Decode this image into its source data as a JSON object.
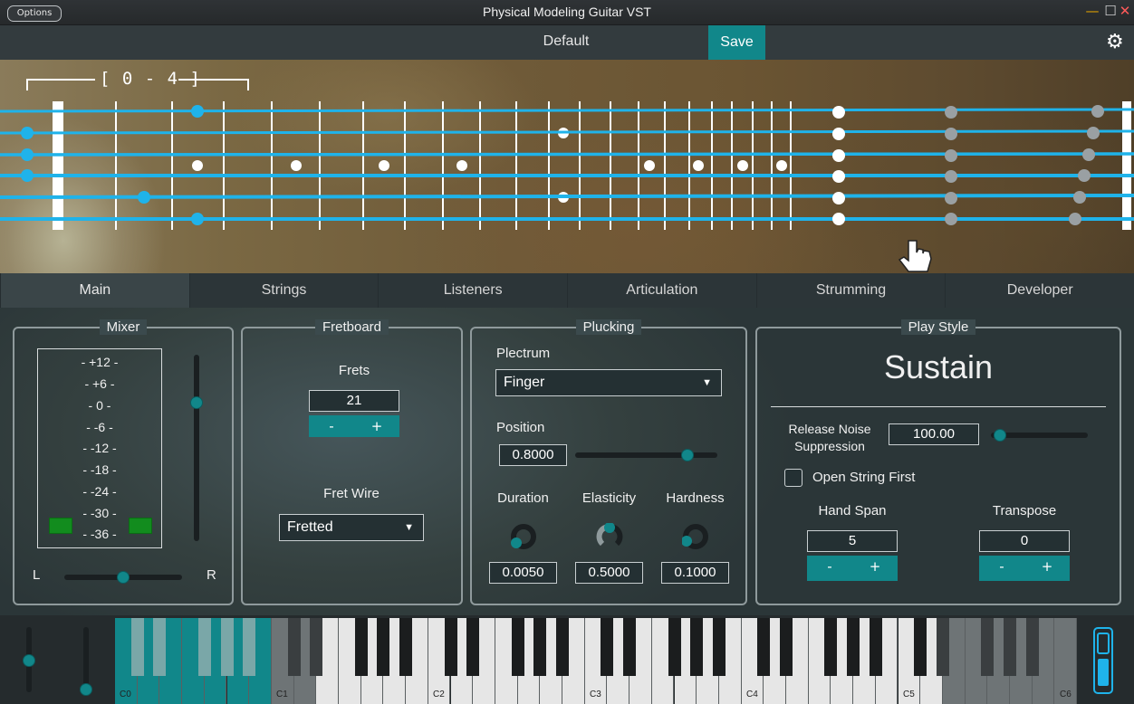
{
  "window": {
    "title": "Physical Modeling Guitar VST",
    "options_label": "Options",
    "minimize": "—",
    "maximize": "☐",
    "close": "✕"
  },
  "preset": {
    "name": "Default",
    "save_label": "Save",
    "settings_icon": "gear-icon"
  },
  "fretboard": {
    "range_label": "[ 0 - 4 ]"
  },
  "tabs": [
    {
      "label": "Main",
      "active": true
    },
    {
      "label": "Strings",
      "active": false
    },
    {
      "label": "Listeners",
      "active": false
    },
    {
      "label": "Articulation",
      "active": false
    },
    {
      "label": "Strumming",
      "active": false
    },
    {
      "label": "Developer",
      "active": false
    }
  ],
  "mixer": {
    "title": "Mixer",
    "db_scale": [
      "- +12 -",
      "- +6 -",
      "- 0 -",
      "- -6 -",
      "- -12 -",
      "- -18 -",
      "- -24 -",
      "- -30 -",
      "- -36 -"
    ],
    "left_label": "L",
    "right_label": "R",
    "volume": 0.62,
    "pan": 0.5
  },
  "fretboard_group": {
    "title": "Fretboard",
    "frets_label": "Frets",
    "frets_value": "21",
    "fret_wire_label": "Fret Wire",
    "fret_wire_value": "Fretted"
  },
  "plucking": {
    "title": "Plucking",
    "plectrum_label": "Plectrum",
    "plectrum_value": "Finger",
    "position_label": "Position",
    "position_value": "0.8000",
    "duration_label": "Duration",
    "duration_value": "0.0050",
    "elasticity_label": "Elasticity",
    "elasticity_value": "0.5000",
    "hardness_label": "Hardness",
    "hardness_value": "0.1000"
  },
  "play_style": {
    "title": "Play Style",
    "mode": "Sustain",
    "release_noise_label_1": "Release Noise",
    "release_noise_label_2": "Suppression",
    "release_noise_value": "100.00",
    "open_string_label": "Open String First",
    "hand_span_label": "Hand Span",
    "hand_span_value": "5",
    "transpose_label": "Transpose",
    "transpose_value": "0"
  },
  "stepper": {
    "minus": "-",
    "plus": "+"
  },
  "keyboard": {
    "octave_labels": [
      "C0",
      "C1",
      "C2",
      "C3",
      "C4",
      "C5",
      "C6"
    ]
  },
  "colors": {
    "accent": "#11878a",
    "string": "#1fb3ea",
    "panel": "#34403f"
  }
}
